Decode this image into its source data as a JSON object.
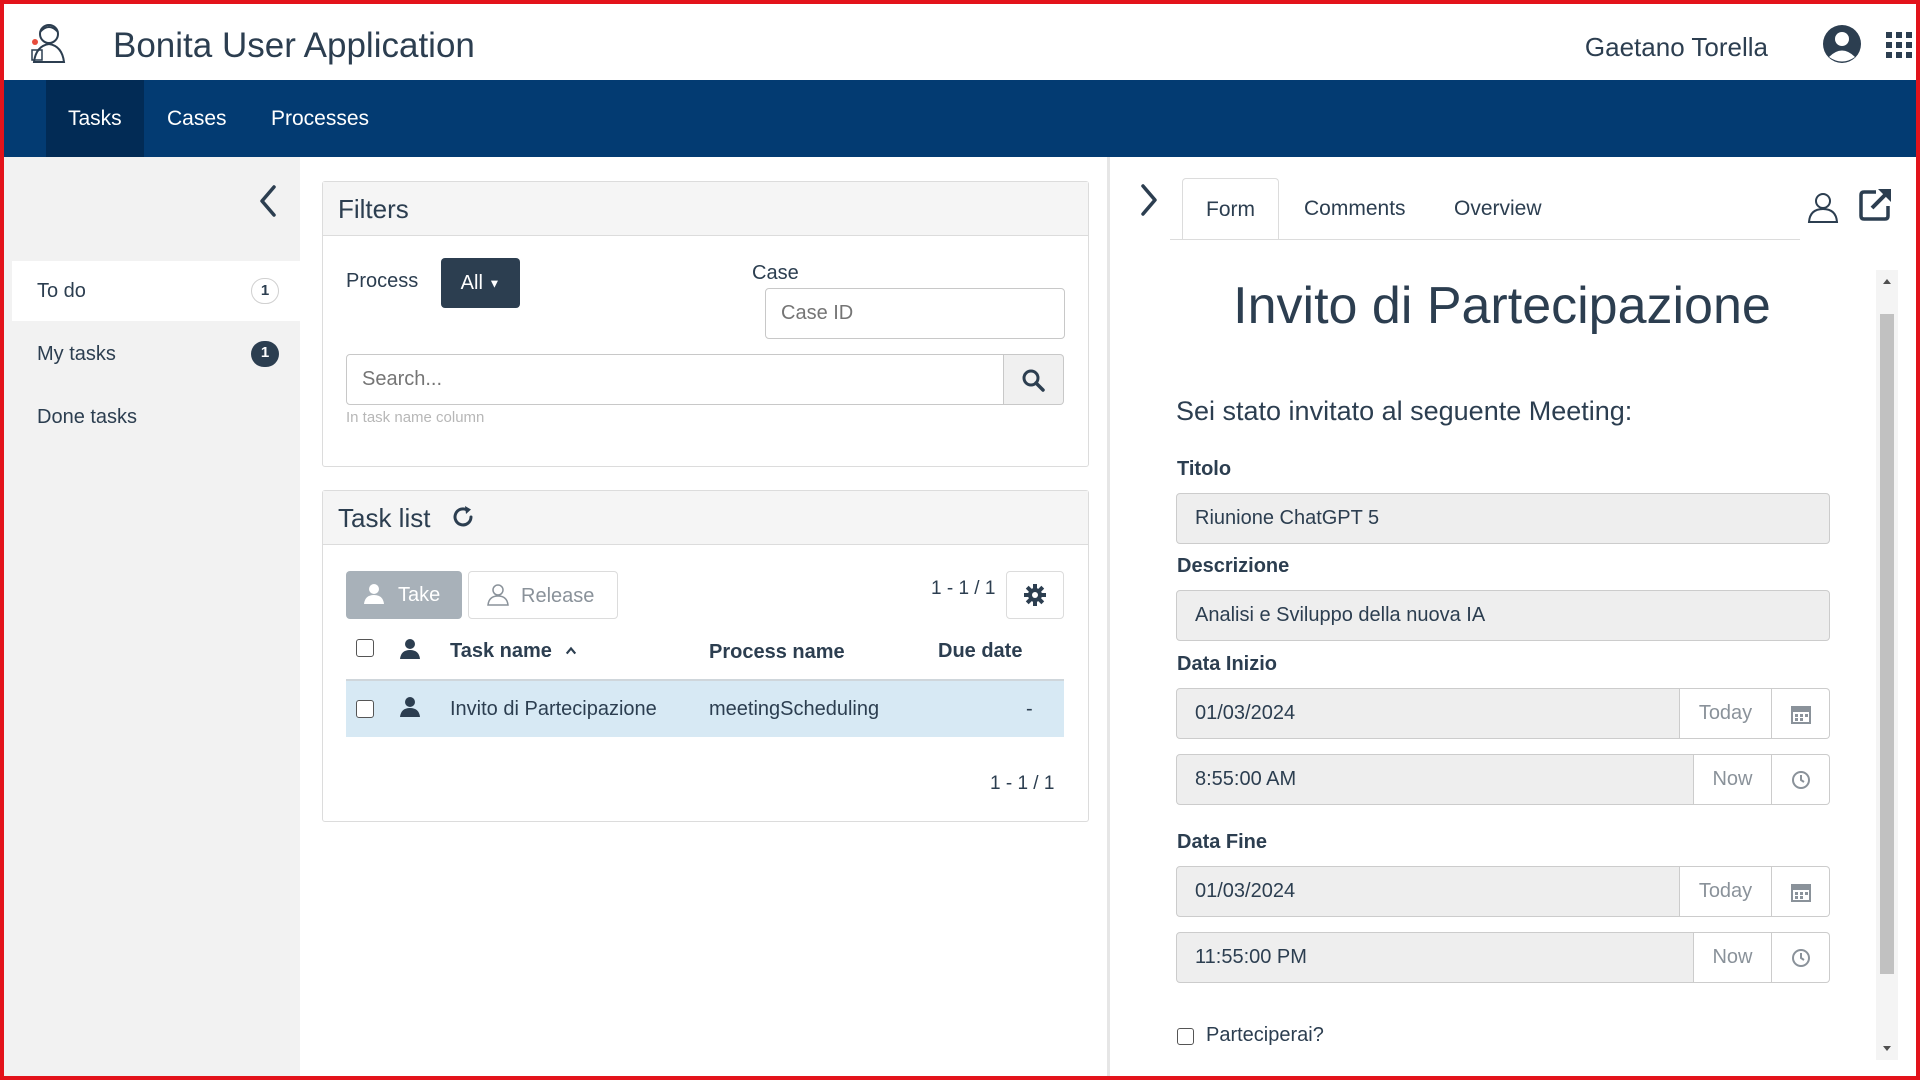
{
  "header": {
    "app_title": "Bonita User Application",
    "username": "Gaetano Torella"
  },
  "nav": {
    "items": [
      {
        "label": "Tasks",
        "active": true
      },
      {
        "label": "Cases",
        "active": false
      },
      {
        "label": "Processes",
        "active": false
      }
    ]
  },
  "sidebar": {
    "items": [
      {
        "label": "To do",
        "count": "1",
        "active": true
      },
      {
        "label": "My tasks",
        "count": "1",
        "active": false
      },
      {
        "label": "Done tasks",
        "count": "",
        "active": false
      }
    ]
  },
  "filters": {
    "title": "Filters",
    "process_label": "Process",
    "process_value": "All",
    "case_label": "Case",
    "case_placeholder": "Case ID",
    "search_placeholder": "Search...",
    "search_hint": "In task name column"
  },
  "tasklist": {
    "title": "Task list",
    "take_label": "Take",
    "release_label": "Release",
    "pager_top": "1 - 1 / 1",
    "pager_bottom": "1 - 1 / 1",
    "columns": [
      "Task name",
      "Process name",
      "Due date"
    ],
    "rows": [
      {
        "task": "Invito di Partecipazione",
        "process": "meetingScheduling",
        "due": "-"
      }
    ]
  },
  "detail": {
    "tabs": [
      {
        "label": "Form",
        "active": true
      },
      {
        "label": "Comments",
        "active": false
      },
      {
        "label": "Overview",
        "active": false
      }
    ],
    "form": {
      "title": "Invito di Partecipazione",
      "subtitle": "Sei stato invitato al seguente Meeting:",
      "titolo_label": "Titolo",
      "titolo_value": "Riunione ChatGPT 5",
      "descrizione_label": "Descrizione",
      "descrizione_value": "Analisi e Sviluppo della nuova IA",
      "data_inizio_label": "Data Inizio",
      "data_inizio_date": "01/03/2024",
      "data_inizio_time": "8:55:00 AM",
      "data_fine_label": "Data Fine",
      "data_fine_date": "01/03/2024",
      "data_fine_time": "11:55:00 PM",
      "today_label": "Today",
      "now_label": "Now",
      "partecipa_label": "Parteciperai?"
    }
  },
  "colors": {
    "navbar": "#033b72",
    "navbar_active": "#022b55",
    "text": "#2c3e50",
    "row_selected": "#d7e9f4",
    "frame": "#e3131b"
  },
  "icons": [
    "logo-icon",
    "user-circle-icon",
    "apps-grid-icon",
    "chevron-left-icon",
    "chevron-right-icon",
    "search-icon",
    "refresh-icon",
    "gear-icon",
    "user-icon",
    "sort-asc-icon",
    "assign-user-icon",
    "popout-icon",
    "calendar-icon",
    "clock-icon"
  ]
}
